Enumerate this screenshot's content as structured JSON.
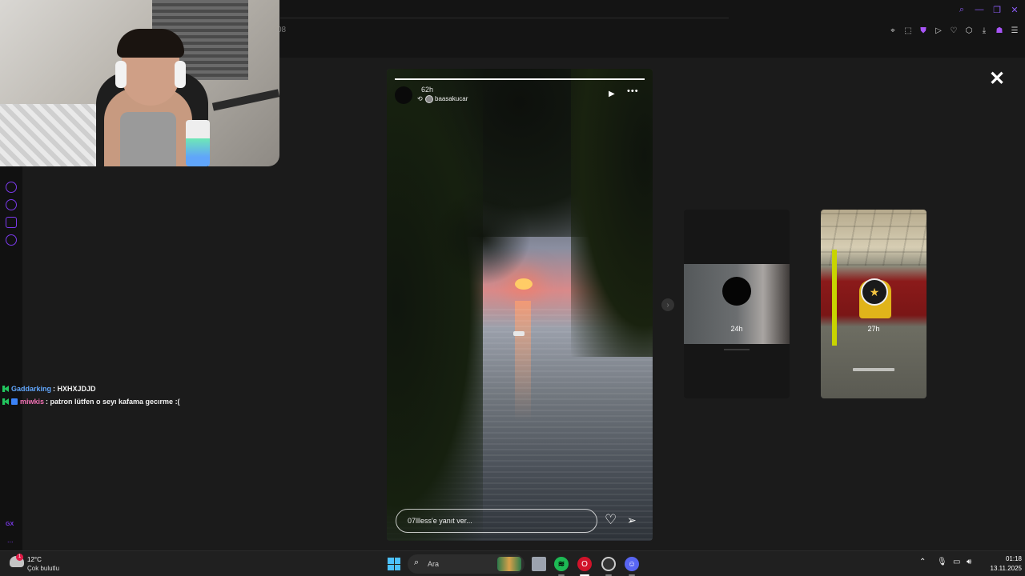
{
  "browser": {
    "tab_fragment": "08",
    "window_controls": [
      "search-icon",
      "minimize-icon",
      "restore-icon",
      "close-icon"
    ],
    "toolbar_icons": [
      "pin-icon",
      "snapshot-icon",
      "shield-icon",
      "play-icon",
      "heart-icon",
      "extensions-icon",
      "download-icon",
      "profile-icon",
      "menu-icon"
    ],
    "accent_color": "#8b5cf6"
  },
  "sidebar": {
    "items": [
      "add-icon",
      "history-icon",
      "extensions-icon",
      "settings-icon"
    ],
    "gx_label": "GX",
    "more_label": "..."
  },
  "chat": [
    {
      "user": "Gaddarking",
      "message": ": HXHXJDJD"
    },
    {
      "user": "miwkis",
      "message": ": patron lütfen o seyı kafama gecırme :("
    }
  ],
  "story": {
    "time": "62h",
    "username": "baasakucar",
    "reply_placeholder": "07llless'e yanıt ver...",
    "progress": 1.0
  },
  "previews": [
    {
      "time": "24h"
    },
    {
      "time": "27h"
    }
  ],
  "taskbar": {
    "weather_temp": "12°C",
    "weather_desc": "Çok bulutlu",
    "weather_badge": "1",
    "search_label": "Ara",
    "clock_time": "01:18",
    "clock_date": "13.11.2025"
  }
}
